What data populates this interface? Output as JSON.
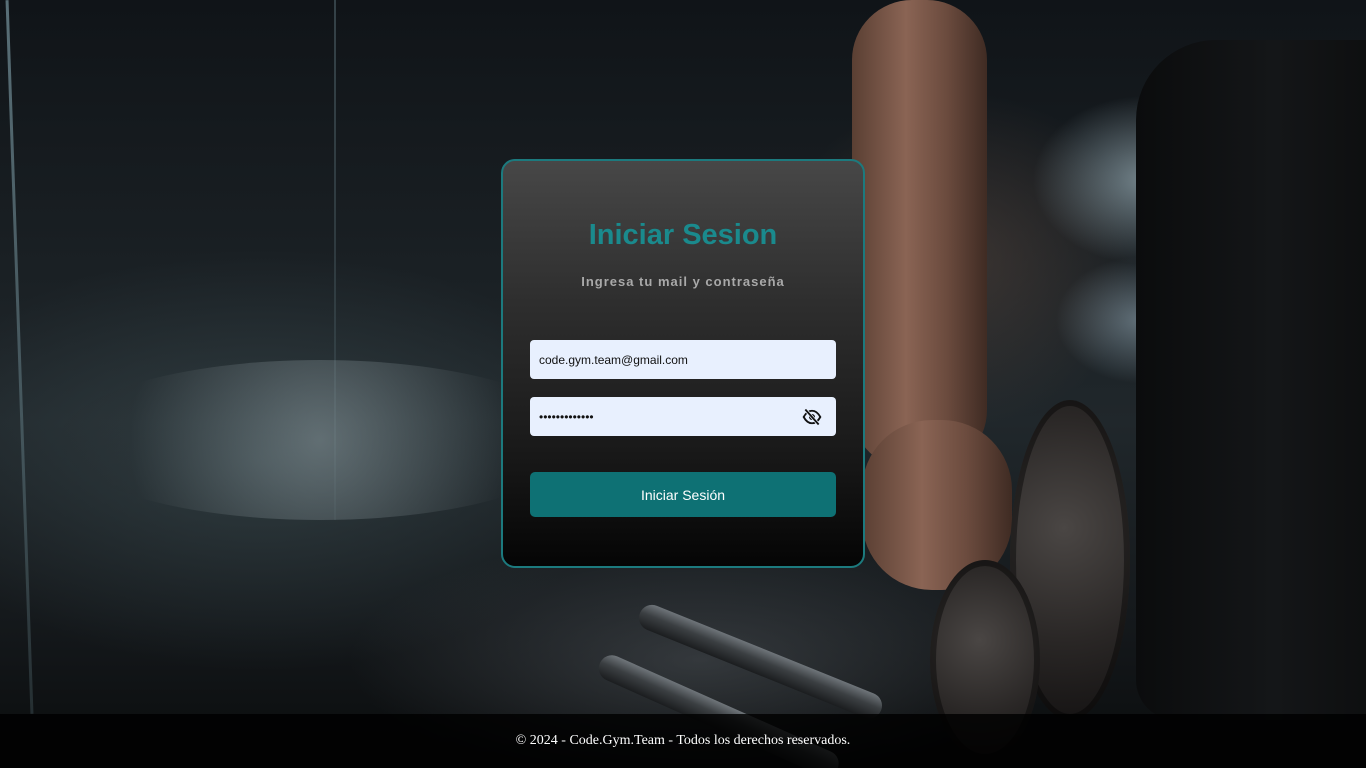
{
  "login": {
    "title": "Iniciar Sesion",
    "subtitle": "Ingresa tu mail y contraseña",
    "email_value": "code.gym.team@gmail.com",
    "password_value": "contrasena123",
    "toggle_icon": "eye-slash-icon",
    "submit_label": "Iniciar Sesión"
  },
  "footer": {
    "text": "© 2024 - Code.Gym.Team - Todos los derechos reservados."
  },
  "colors": {
    "accent": "#1a8a8d",
    "button": "#0e7174",
    "input_bg": "#e8f0fe"
  }
}
